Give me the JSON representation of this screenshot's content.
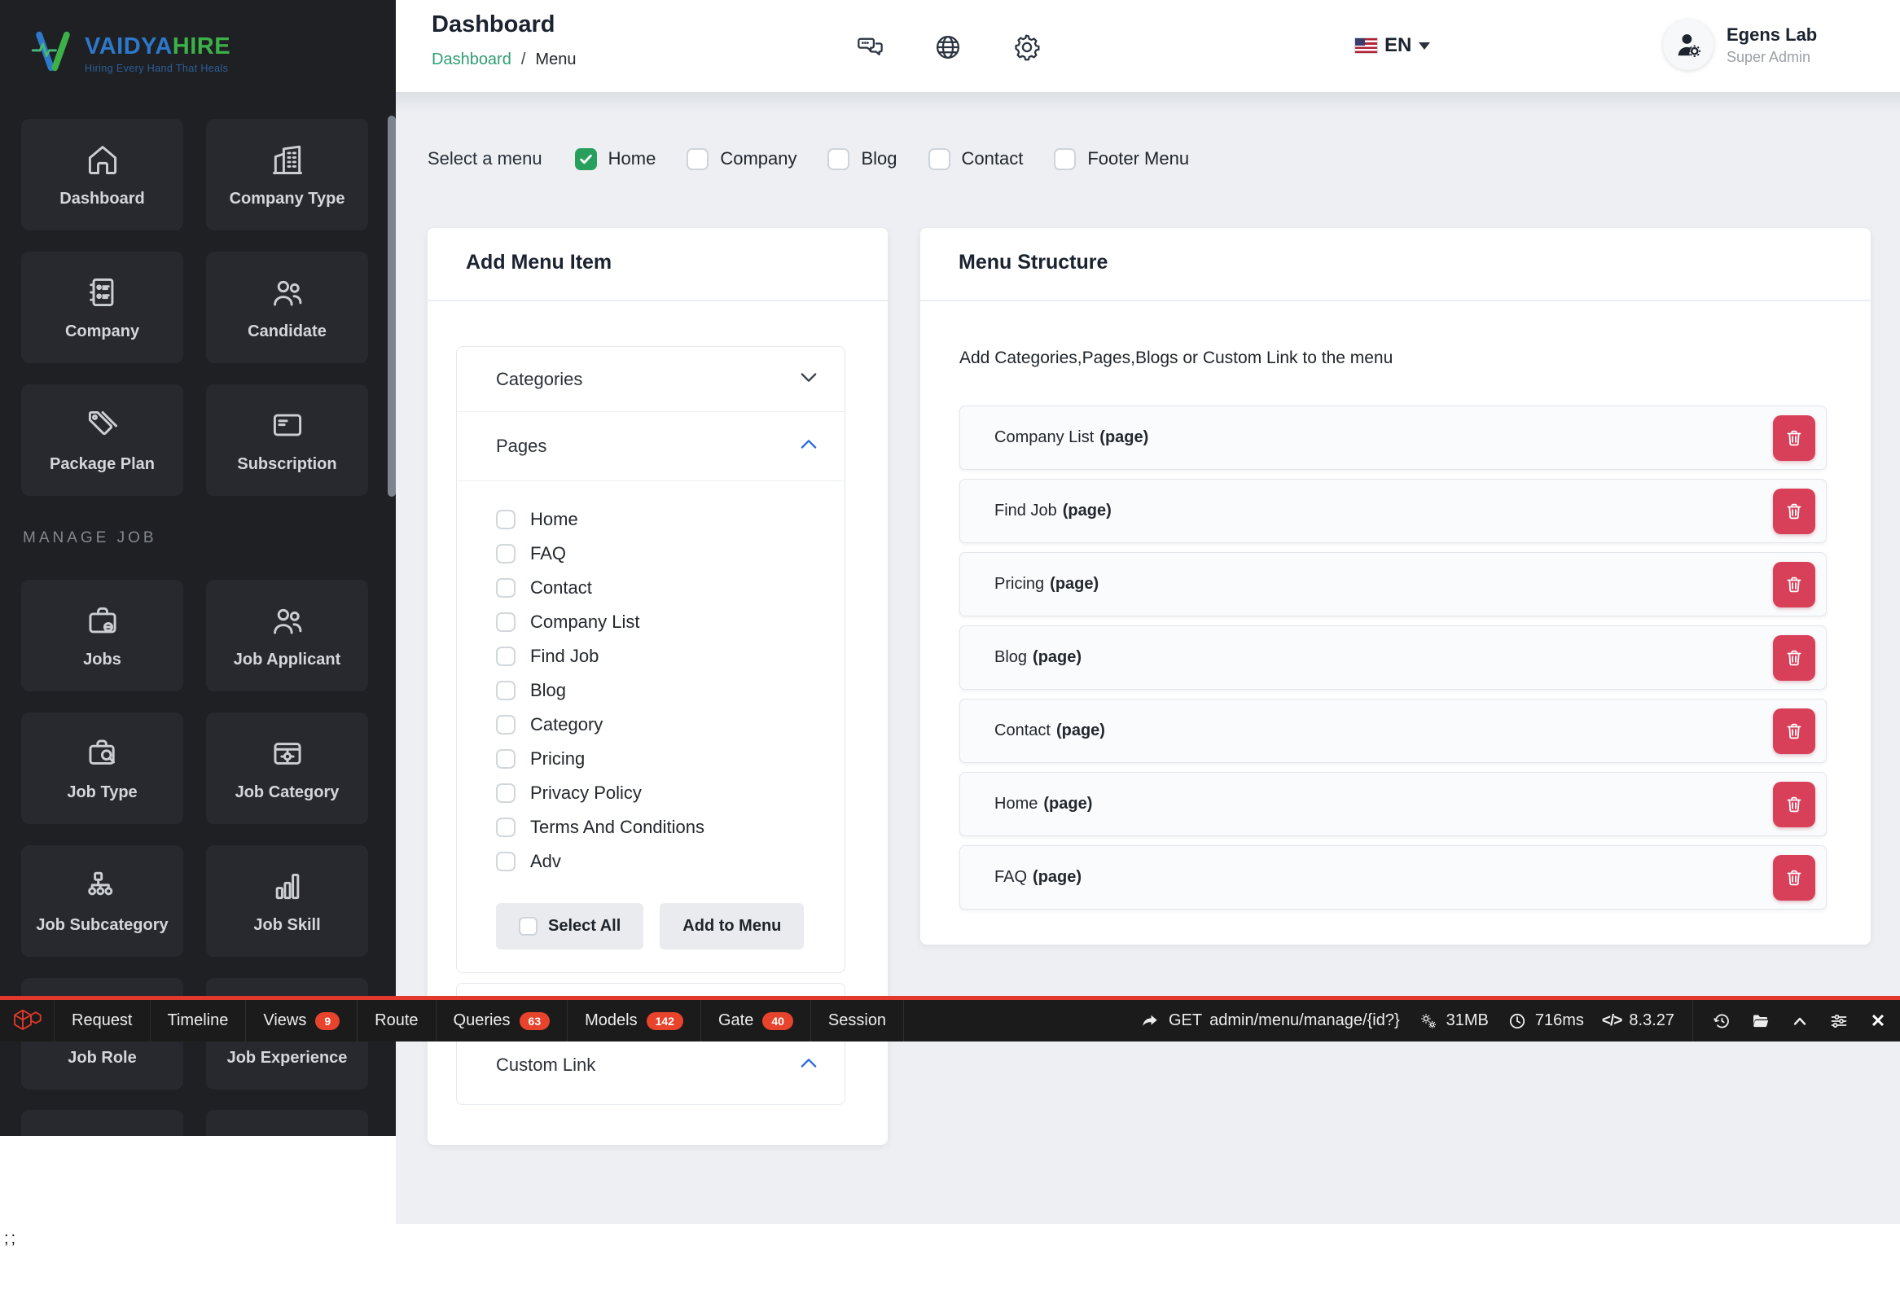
{
  "brand": {
    "name_primary": "VAIDYA",
    "name_secondary": "HIRE",
    "tagline": "Hiring Every Hand That Heals"
  },
  "sidebar": {
    "tiles": [
      {
        "label": "Dashboard",
        "icon": "home-icon"
      },
      {
        "label": "Company Type",
        "icon": "building-icon"
      },
      {
        "label": "Company",
        "icon": "list-card-icon"
      },
      {
        "label": "Candidate",
        "icon": "people-icon"
      },
      {
        "label": "Package Plan",
        "icon": "tags-icon"
      },
      {
        "label": "Subscription",
        "icon": "credit-card-icon"
      }
    ],
    "section_label": "MANAGE JOB",
    "job_tiles": [
      {
        "label": "Jobs",
        "icon": "briefcase-link-icon"
      },
      {
        "label": "Job Applicant",
        "icon": "people-icon"
      },
      {
        "label": "Job Type",
        "icon": "briefcase-search-icon"
      },
      {
        "label": "Job Category",
        "icon": "card-gear-icon"
      },
      {
        "label": "Job Subcategory",
        "icon": "sitemap-icon"
      },
      {
        "label": "Job Skill",
        "icon": "bar-chart-icon"
      },
      {
        "label": "Job Role",
        "icon": "person-icon"
      },
      {
        "label": "Job Experience",
        "icon": "person-badge-icon"
      }
    ]
  },
  "header": {
    "title": "Dashboard",
    "breadcrumb": {
      "root": "Dashboard",
      "separator": "/",
      "current": "Menu"
    },
    "language": "EN",
    "user": {
      "name": "Egens Lab",
      "role": "Super Admin"
    }
  },
  "menu_select": {
    "label": "Select a menu",
    "options": [
      {
        "label": "Home",
        "checked": true
      },
      {
        "label": "Company",
        "checked": false
      },
      {
        "label": "Blog",
        "checked": false
      },
      {
        "label": "Contact",
        "checked": false
      },
      {
        "label": "Footer Menu",
        "checked": false
      }
    ]
  },
  "add_menu_item": {
    "title": "Add Menu Item",
    "categories_label": "Categories",
    "pages_label": "Pages",
    "pages": [
      "Home",
      "FAQ",
      "Contact",
      "Company List",
      "Find Job",
      "Blog",
      "Category",
      "Pricing",
      "Privacy Policy",
      "Terms And Conditions",
      "Adv"
    ],
    "select_all_label": "Select All",
    "add_to_menu_label": "Add to Menu",
    "custom_link_label": "Custom Link"
  },
  "menu_structure": {
    "title": "Menu Structure",
    "description": "Add Categories,Pages,Blogs or Custom Link to the menu",
    "items": [
      {
        "name": "Company List",
        "type": "page"
      },
      {
        "name": "Find Job",
        "type": "page"
      },
      {
        "name": "Pricing",
        "type": "page"
      },
      {
        "name": "Blog",
        "type": "page"
      },
      {
        "name": "Contact",
        "type": "page"
      },
      {
        "name": "Home",
        "type": "page"
      },
      {
        "name": "FAQ",
        "type": "page"
      }
    ]
  },
  "debugbar": {
    "tabs": [
      {
        "label": "Request"
      },
      {
        "label": "Timeline"
      },
      {
        "label": "Views",
        "badge": "9"
      },
      {
        "label": "Route"
      },
      {
        "label": "Queries",
        "badge": "63"
      },
      {
        "label": "Models",
        "badge": "142"
      },
      {
        "label": "Gate",
        "badge": "40"
      },
      {
        "label": "Session"
      }
    ],
    "request_method": "GET",
    "request_path": "admin/menu/manage/{id?}",
    "memory": "31MB",
    "time": "716ms",
    "php_version": "8.3.27"
  },
  "stray_text": ";;",
  "colors": {
    "accent_green": "#27a05e",
    "breadcrumb_green": "#2e9e72",
    "accent_blue": "#2f6be4",
    "danger_red": "#d8405a",
    "debugbar_red": "#e2392c",
    "brand_blue": "#2e78c9",
    "brand_green": "#3cb049",
    "sidebar_bg": "#1e2024",
    "tile_bg": "#27292e",
    "main_bg": "#edeff3"
  }
}
